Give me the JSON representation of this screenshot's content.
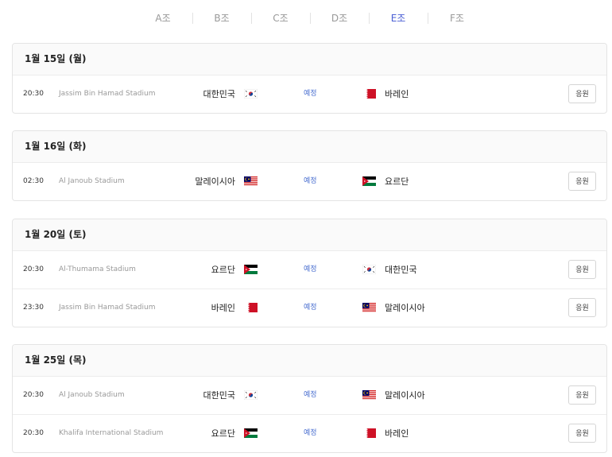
{
  "tabs": [
    {
      "label": "A조",
      "active": false
    },
    {
      "label": "B조",
      "active": false
    },
    {
      "label": "C조",
      "active": false
    },
    {
      "label": "D조",
      "active": false
    },
    {
      "label": "E조",
      "active": true
    },
    {
      "label": "F조",
      "active": false
    }
  ],
  "days": [
    {
      "date": "1월 15일 (월)",
      "matches": [
        {
          "time": "20:30",
          "stadium": "Jassim Bin Hamad Stadium",
          "home": "대한민국",
          "home_flag": "korea-flag-icon",
          "status": "예정",
          "away": "바레인",
          "away_flag": "bahrain-flag-icon",
          "cheer": "응원"
        }
      ]
    },
    {
      "date": "1월 16일 (화)",
      "matches": [
        {
          "time": "02:30",
          "stadium": "Al Janoub Stadium",
          "home": "말레이시아",
          "home_flag": "malaysia-flag-icon",
          "status": "예정",
          "away": "요르단",
          "away_flag": "jordan-flag-icon",
          "cheer": "응원"
        }
      ]
    },
    {
      "date": "1월 20일 (토)",
      "matches": [
        {
          "time": "20:30",
          "stadium": "Al-Thumama Stadium",
          "home": "요르단",
          "home_flag": "jordan-flag-icon",
          "status": "예정",
          "away": "대한민국",
          "away_flag": "korea-flag-icon",
          "cheer": "응원"
        },
        {
          "time": "23:30",
          "stadium": "Jassim Bin Hamad Stadium",
          "home": "바레인",
          "home_flag": "bahrain-flag-icon",
          "status": "예정",
          "away": "말레이시아",
          "away_flag": "malaysia-flag-icon",
          "cheer": "응원"
        }
      ]
    },
    {
      "date": "1월 25일 (목)",
      "matches": [
        {
          "time": "20:30",
          "stadium": "Al Janoub Stadium",
          "home": "대한민국",
          "home_flag": "korea-flag-icon",
          "status": "예정",
          "away": "말레이시아",
          "away_flag": "malaysia-flag-icon",
          "cheer": "응원"
        },
        {
          "time": "20:30",
          "stadium": "Khalifa International Stadium",
          "home": "요르단",
          "home_flag": "jordan-flag-icon",
          "status": "예정",
          "away": "바레인",
          "away_flag": "bahrain-flag-icon",
          "cheer": "응원"
        }
      ]
    }
  ],
  "colors": {
    "active_tab": "#4a5fd4",
    "status": "#4a6fd0"
  }
}
